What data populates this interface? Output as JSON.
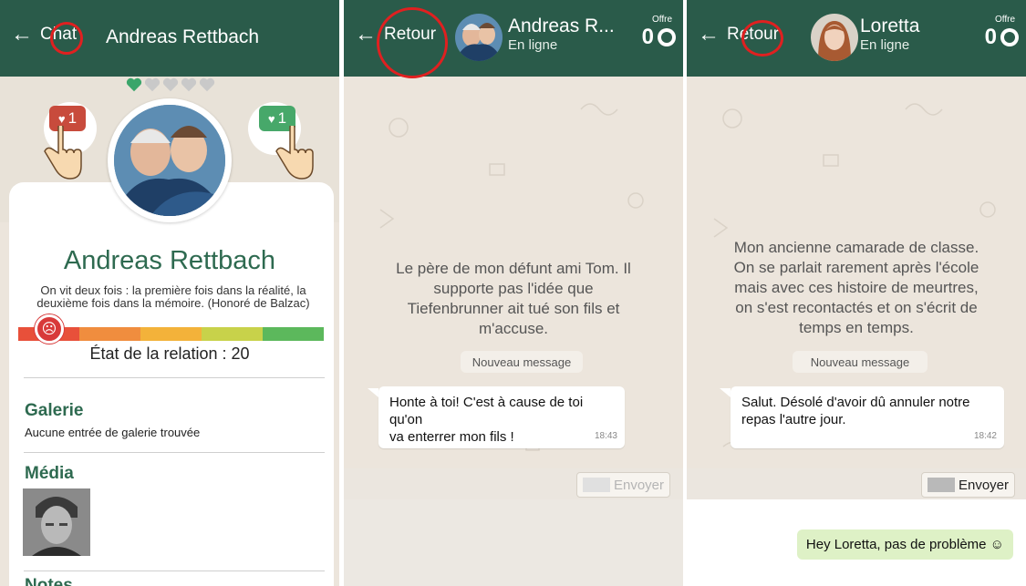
{
  "panel1": {
    "back_label": "Chat",
    "title": "Andreas Rettbach",
    "dislike_count": "1",
    "like_count": "1",
    "name": "Andreas Rettbach",
    "quote_line1": "On vit deux fois : la première fois dans la réalité, la",
    "quote_line2": "deuxième fois dans la mémoire. (Honoré de Balzac)",
    "relation_label": "État de la relation : 20",
    "relation_value": 20,
    "meter_colors": [
      "#e8503a",
      "#f08d3e",
      "#f3b23a",
      "#c8d24a",
      "#5cb85c"
    ],
    "gallery_title": "Galerie",
    "gallery_text": "Aucune entrée de galerie trouvée",
    "media_title": "Média",
    "next_title": "Notes"
  },
  "panel2": {
    "back_label": "Retour",
    "chat_name": "Andreas R...",
    "status": "En ligne",
    "offer_label": "Offre",
    "offer_value": "0",
    "system_line1": "Le père de mon défunt ami Tom. Il",
    "system_line2": "supporte pas l'idée  que",
    "system_line3": "Tiefenbrunner ait tué son fils et",
    "system_line4": "m'accuse.",
    "new_message_label": "Nouveau message",
    "message_line1": "Honte à toi! C'est à cause de toi qu'on",
    "message_line2": "va enterrer mon fils !",
    "message_time": "18:43",
    "send_label": "Envoyer"
  },
  "panel3": {
    "back_label": "Retour",
    "chat_name": "Loretta",
    "status": "En ligne",
    "offer_label": "Offre",
    "offer_value": "0",
    "system_line1": "Mon ancienne camarade de classe.",
    "system_line2": "On se parlait rarement après l'école",
    "system_line3": "mais avec ces histoire de meurtres,",
    "system_line4": "on s'est recontactés et on s'écrit de",
    "system_line5": "temps en temps.",
    "new_message_label": "Nouveau message",
    "message_line1": "Salut. Désolé d'avoir dû annuler notre",
    "message_line2": "repas l'autre jour.",
    "message_time": "18:42",
    "send_label": "Envoyer",
    "reply_option": "Hey Loretta, pas de problème ☺"
  },
  "colors": {
    "header": "#2a5b4a",
    "accent_green": "#2e6a50",
    "highlight_red": "#e02020"
  }
}
